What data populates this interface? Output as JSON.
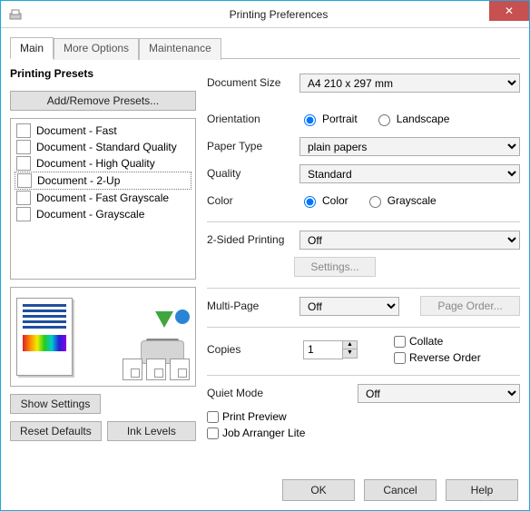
{
  "window": {
    "title": "Printing Preferences"
  },
  "tabs": {
    "main": "Main",
    "more": "More Options",
    "maint": "Maintenance"
  },
  "presets": {
    "heading": "Printing Presets",
    "addRemove": "Add/Remove Presets...",
    "items": [
      "Document - Fast",
      "Document - Standard Quality",
      "Document - High Quality",
      "Document - 2-Up",
      "Document - Fast Grayscale",
      "Document - Grayscale"
    ]
  },
  "leftButtons": {
    "showSettings": "Show Settings",
    "resetDefaults": "Reset Defaults",
    "inkLevels": "Ink Levels"
  },
  "fields": {
    "documentSize": {
      "label": "Document Size",
      "value": "A4 210 x 297 mm"
    },
    "orientation": {
      "label": "Orientation",
      "portrait": "Portrait",
      "landscape": "Landscape",
      "selected": "portrait"
    },
    "paperType": {
      "label": "Paper Type",
      "value": "plain papers"
    },
    "quality": {
      "label": "Quality",
      "value": "Standard"
    },
    "color": {
      "label": "Color",
      "color": "Color",
      "grayscale": "Grayscale",
      "selected": "color"
    },
    "twoSided": {
      "label": "2-Sided Printing",
      "value": "Off",
      "settings": "Settings..."
    },
    "multiPage": {
      "label": "Multi-Page",
      "value": "Off",
      "pageOrder": "Page Order..."
    },
    "copies": {
      "label": "Copies",
      "value": "1",
      "collate": "Collate",
      "reverse": "Reverse Order"
    },
    "quietMode": {
      "label": "Quiet Mode",
      "value": "Off"
    },
    "printPreview": "Print Preview",
    "jobArranger": "Job Arranger Lite"
  },
  "footer": {
    "ok": "OK",
    "cancel": "Cancel",
    "help": "Help"
  }
}
